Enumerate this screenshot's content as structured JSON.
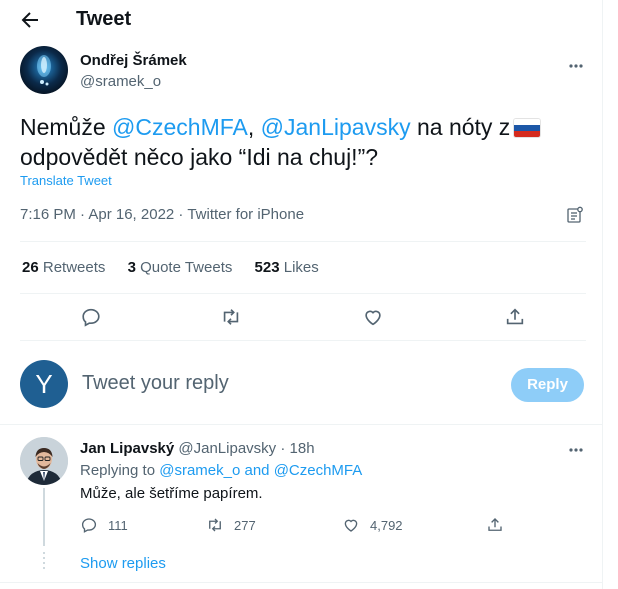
{
  "header": {
    "title": "Tweet"
  },
  "tweet": {
    "author_name": "Ondřej Šrámek",
    "author_handle": "@sramek_o",
    "text_part1": "Nemůže ",
    "mention1": "@CzechMFA",
    "text_part2": ", ",
    "mention2": "@JanLipavsky",
    "text_part3": " na nóty z",
    "text_part4": "odpovědět něco jako “Idi na chuj!”?",
    "flag_colors": [
      "#ffffff",
      "#1c57a7",
      "#d52b1e"
    ],
    "translate_label": "Translate Tweet",
    "meta": "7:16 PM · Apr 16, 2022 · Twitter for iPhone",
    "stats": {
      "retweets_count": "26",
      "retweets_label": "Retweets",
      "quotes_count": "3",
      "quotes_label": "Quote Tweets",
      "likes_count": "523",
      "likes_label": "Likes"
    }
  },
  "compose": {
    "avatar_letter": "Y",
    "placeholder": "Tweet your reply",
    "reply_button": "Reply"
  },
  "reply": {
    "name": "Jan Lipavský",
    "handle": "@JanLipavsky",
    "separator": "·",
    "time": "18h",
    "replying_prefix": "Replying to ",
    "replying_user1": "@sramek_o",
    "replying_and": " and ",
    "replying_user2": "@CzechMFA",
    "text": "Může, ale šetříme papírem.",
    "reply_count": "111",
    "retweet_count": "277",
    "like_count": "4,792",
    "show_replies": "Show replies"
  },
  "colors": {
    "accent": "#1d9bf0",
    "muted": "#536471",
    "reply_button_bg": "#8ecdf8"
  }
}
